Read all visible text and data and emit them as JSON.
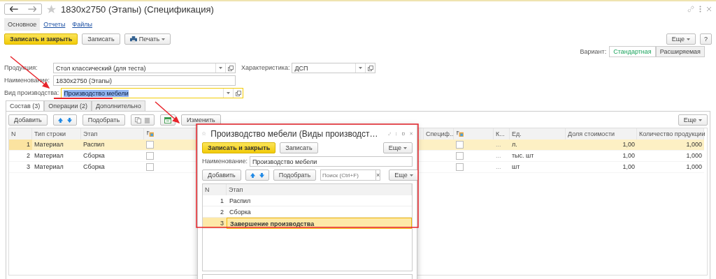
{
  "window": {
    "title": "1830x2750 (Этапы) (Спецификация)"
  },
  "nav_tabs": [
    {
      "label": "Основное",
      "selected": true
    },
    {
      "label": "Отчеты",
      "selected": false
    },
    {
      "label": "Файлы",
      "selected": false
    }
  ],
  "command_bar": {
    "buttons": [
      {
        "label": "Записать и закрыть",
        "kind": "primary"
      },
      {
        "label": "Записать",
        "kind": "plain"
      },
      {
        "label": "Печать",
        "kind": "print"
      }
    ],
    "more": "Еще",
    "help": "?"
  },
  "variant": {
    "label": "Вариант:",
    "options": [
      {
        "label": "Стандартная",
        "selected": true
      },
      {
        "label": "Расширяемая",
        "selected": false
      }
    ]
  },
  "form_rows": [
    {
      "fields": [
        {
          "label": "Продукция:",
          "value": "Стол классический (для теста)",
          "kind": "select",
          "focused": false
        },
        {
          "label": "Характеристика:",
          "value": "ДСП",
          "kind": "select_short",
          "focused": false
        }
      ]
    },
    {
      "fields": [
        {
          "label": "Наименование:",
          "value": "1830x2750 (Этапы)",
          "kind": "text",
          "focused": false
        }
      ]
    },
    {
      "fields": [
        {
          "label": "Вид производства:",
          "value": "Производство мебели",
          "kind": "select",
          "focused": true
        }
      ]
    }
  ],
  "section_tabs": [
    {
      "label": "Состав (3)",
      "selected": true
    },
    {
      "label": "Операции (2)",
      "selected": false
    },
    {
      "label": "Дополнительно",
      "selected": false
    }
  ],
  "table_toolbar": {
    "add": "Добавить",
    "pick": "Подобрать",
    "edit": "Изменить",
    "more": "Еще"
  },
  "table": {
    "columns": [
      {
        "label": "N",
        "kind": "text"
      },
      {
        "label": "Тип строки",
        "kind": "text"
      },
      {
        "label": "Этап",
        "kind": "text"
      },
      {
        "kind": "icon"
      },
      {
        "label": "Специф...",
        "kind": "text"
      },
      {
        "kind": "icon"
      },
      {
        "label": "К...",
        "kind": "text"
      },
      {
        "label": "Ед.",
        "kind": "text"
      },
      {
        "label": "Доля стоимости",
        "kind": "text"
      },
      {
        "label": "Количество продукции",
        "kind": "text"
      }
    ],
    "rows": [
      {
        "selected": true,
        "n": "1",
        "type": "Материал",
        "stage": "Распил",
        "flag_1": false,
        "flag_2": false,
        "k": "...",
        "unit": "л.",
        "share": "1,00",
        "qty": "1,000"
      },
      {
        "selected": false,
        "n": "2",
        "type": "Материал",
        "stage": "Сборка",
        "flag_1": false,
        "flag_2": false,
        "k": "...",
        "unit": "тыс. шт",
        "share": "1,00",
        "qty": "1,000"
      },
      {
        "selected": false,
        "n": "3",
        "type": "Материал",
        "stage": "Сборка",
        "flag_1": false,
        "flag_2": false,
        "k": "...",
        "unit": "шт",
        "share": "1,00",
        "qty": "1,000"
      }
    ]
  },
  "dialog": {
    "title": "Производство мебели (Виды производст…",
    "buttons": [
      {
        "label": "Записать и закрыть",
        "kind": "primary"
      },
      {
        "label": "Записать",
        "kind": "plain"
      }
    ],
    "more": "Еще",
    "name_field": {
      "label": "Наименование:",
      "value": "Производство мебели"
    },
    "toolbar": {
      "add": "Добавить",
      "pick": "Подобрать",
      "search_placeholder": "Поиск (Ctrl+F)",
      "clear": "×",
      "more": "Еще"
    },
    "table": {
      "columns": [
        "N",
        "Этап"
      ],
      "rows": [
        {
          "n": "1",
          "stage": "Распил",
          "selected": false
        },
        {
          "n": "2",
          "stage": "Сборка",
          "selected": false
        },
        {
          "n": "3",
          "stage": "Завершение производства",
          "selected": true
        }
      ]
    }
  }
}
